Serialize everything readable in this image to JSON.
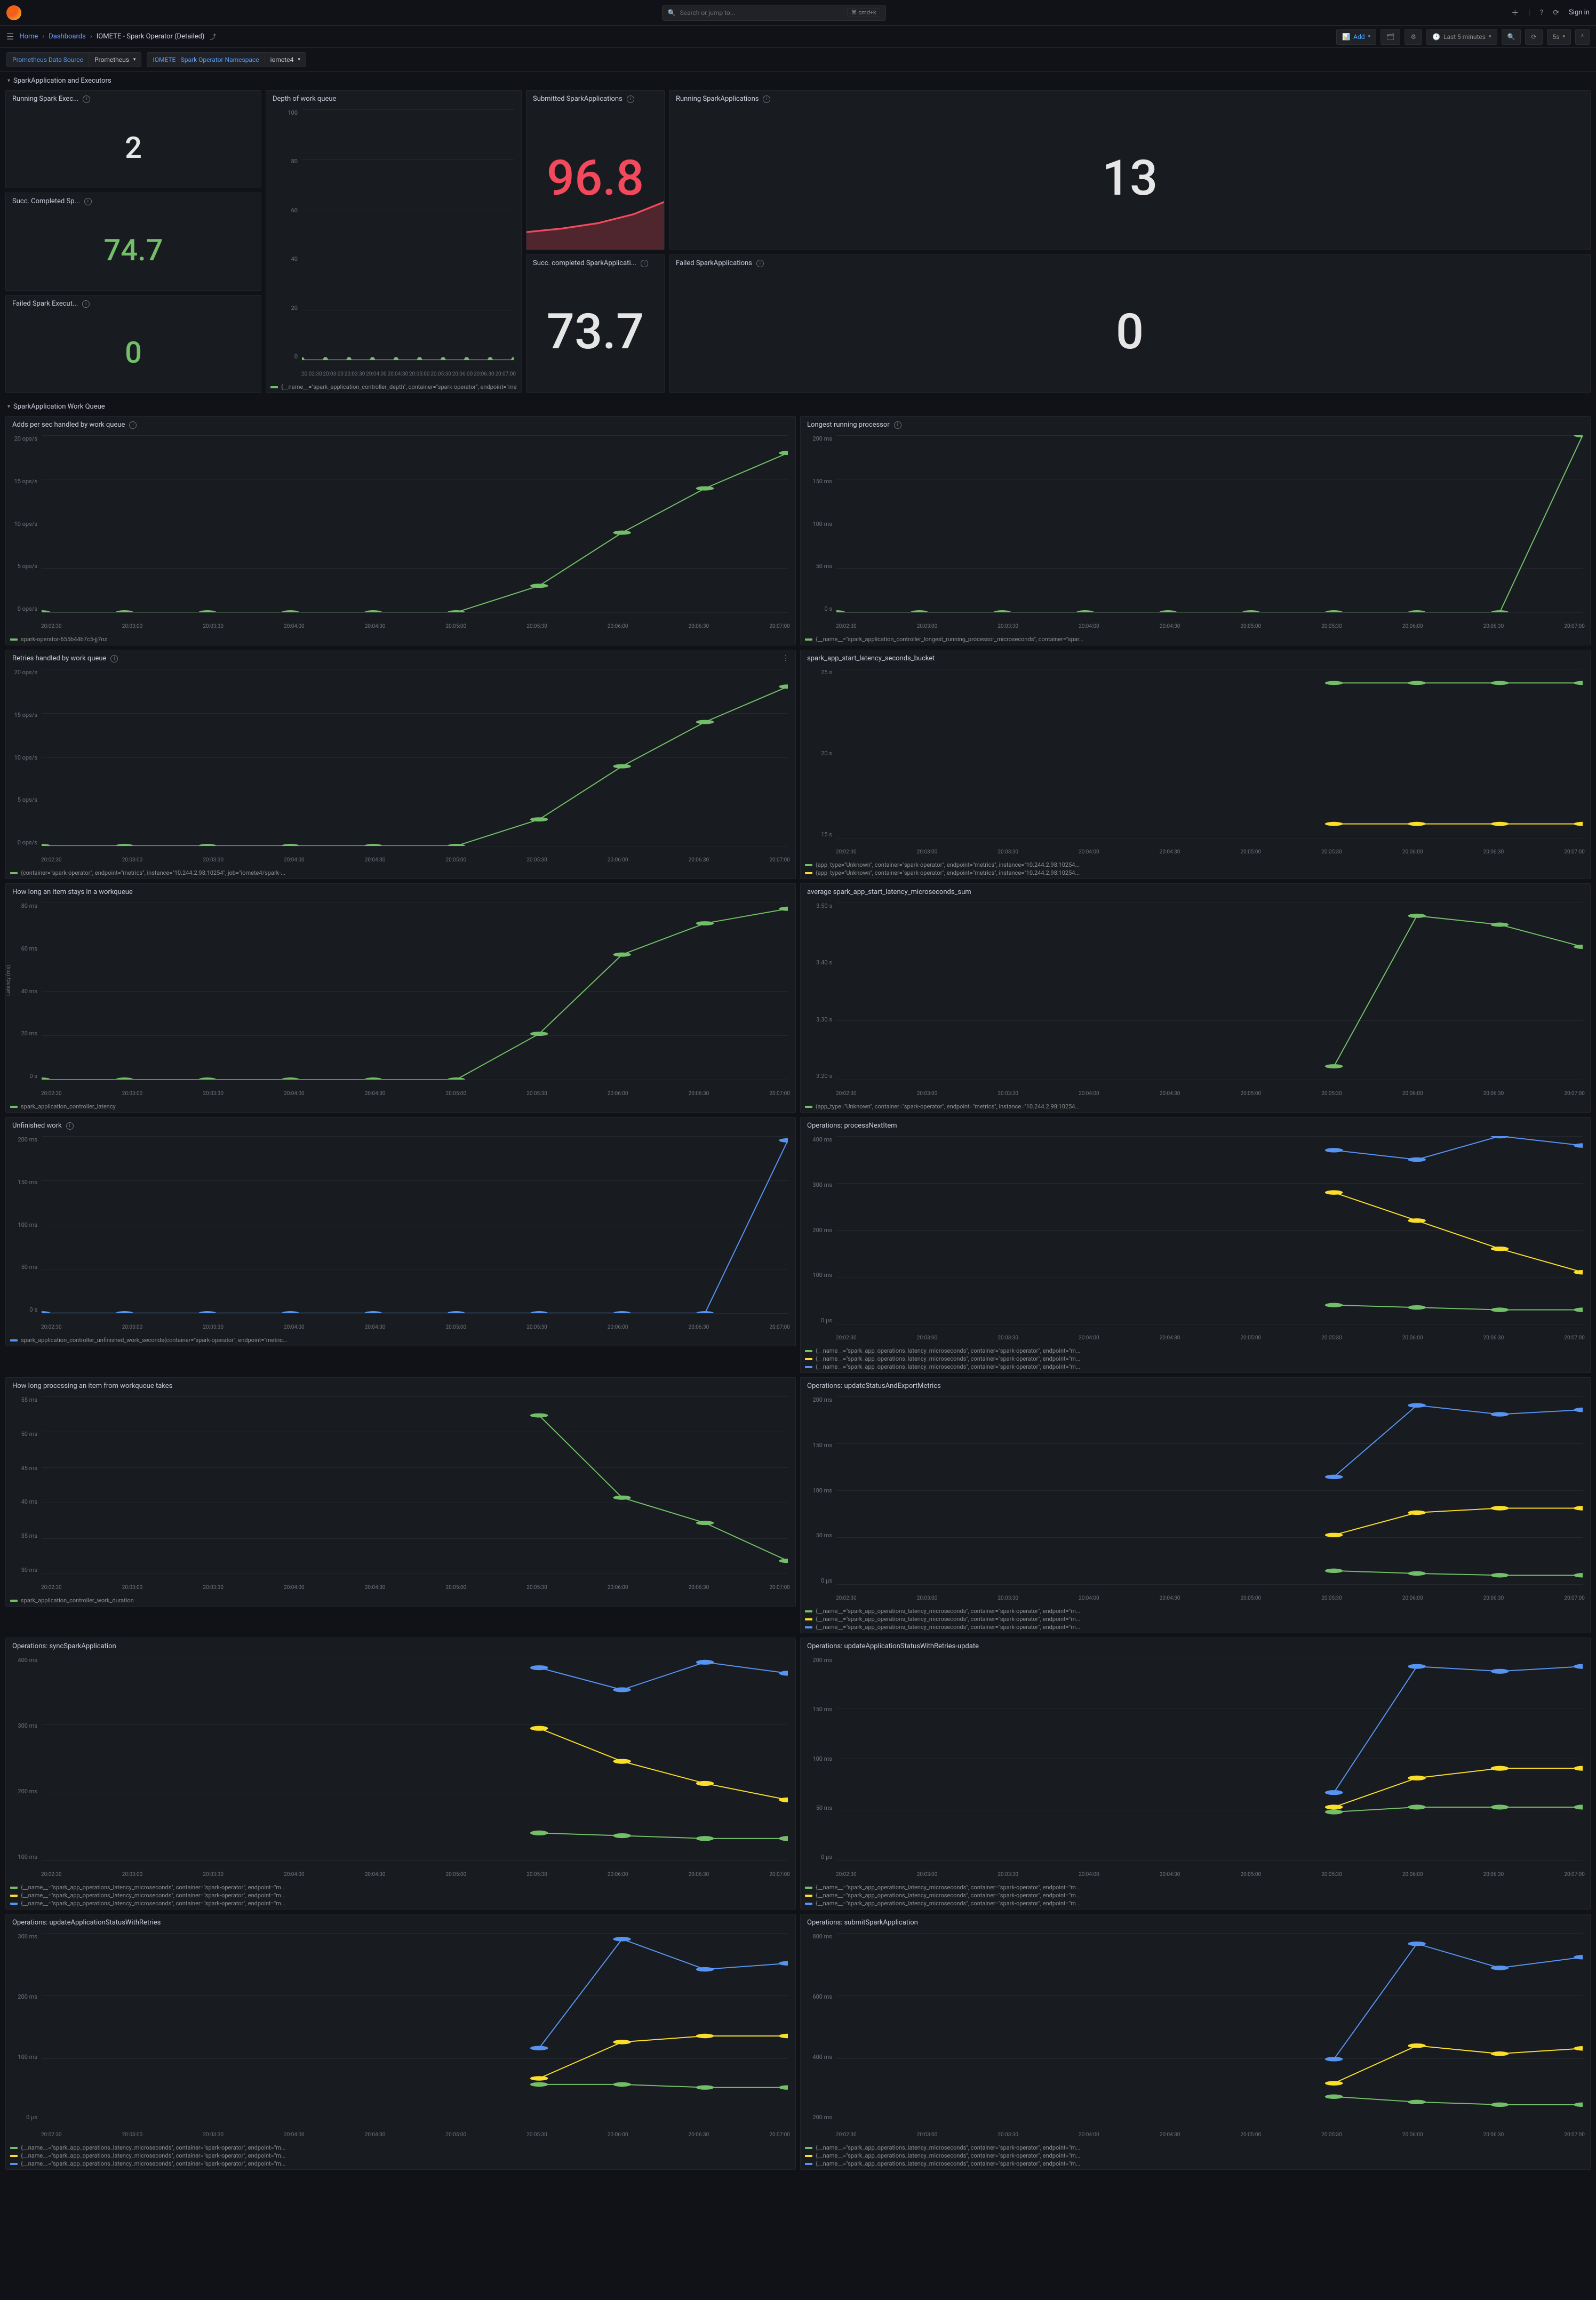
{
  "nav": {
    "search_placeholder": "Search or jump to...",
    "kbd": "⌘ cmd+k",
    "signin": "Sign in"
  },
  "breadcrumbs": {
    "home": "Home",
    "dashboards": "Dashboards",
    "current": "IOMETE - Spark Operator (Detailed)"
  },
  "toolbar": {
    "add": "Add",
    "timerange": "Last 5 minutes",
    "refresh": "5s"
  },
  "vars": {
    "ds_label": "Prometheus Data Source",
    "ds_value": "Prometheus",
    "ns_label": "IOMETE - Spark Operator Namespace",
    "ns_value": "iomete4"
  },
  "sections": {
    "s1": "SparkApplication and Executors",
    "s2": "SparkApplication Work Queue"
  },
  "xticks": [
    "20:02:30",
    "20:03:00",
    "20:03:30",
    "20:04:00",
    "20:04:30",
    "20:05:00",
    "20:05:30",
    "20:06:00",
    "20:06:30",
    "20:07:00"
  ],
  "stats": {
    "submitted": {
      "title": "Submitted SparkApplications",
      "value": "96.8",
      "color": "red",
      "spark": true
    },
    "running": {
      "title": "Running SparkApplications",
      "value": "13",
      "color": "white"
    },
    "succ_pct": {
      "title": "Succ. completed SparkApplicati...",
      "value": "73.7",
      "color": "white"
    },
    "failed": {
      "title": "Failed SparkApplications",
      "value": "0",
      "color": "white"
    },
    "running_exec": {
      "title": "Running Spark Exec...",
      "value": "2",
      "color": "white"
    },
    "succ_sp": {
      "title": "Succ. Completed Sp...",
      "value": "74.7",
      "color": "green"
    },
    "failed_exec": {
      "title": "Failed Spark Execut...",
      "value": "0",
      "color": "green"
    }
  },
  "chart_data": [
    {
      "id": "depth",
      "title": "Depth of work queue",
      "ylim": [
        0,
        100
      ],
      "yticks": [
        "100",
        "80",
        "60",
        "40",
        "20",
        "0"
      ],
      "series": [
        {
          "name": "{__name__=\"spark_application_controller_depth\", container=\"spark-operator\", endpoint=\"metrics\", inst...",
          "color": "#73bf69",
          "values": [
            0,
            0,
            0,
            0,
            0,
            0,
            0,
            0,
            0,
            0
          ]
        }
      ]
    },
    {
      "id": "adds",
      "title": "Adds per sec handled by work queue",
      "ylim": [
        0,
        20
      ],
      "yticks": [
        "20 ops/s",
        "15 ops/s",
        "10 ops/s",
        "5 ops/s",
        "0 ops/s"
      ],
      "series": [
        {
          "name": "spark-operator-655b44b7c5-jj7nz",
          "color": "#73bf69",
          "values": [
            0,
            0,
            0,
            0,
            0,
            0,
            3,
            9,
            14,
            18
          ]
        }
      ]
    },
    {
      "id": "longest",
      "title": "Longest running processor",
      "ylim": [
        0,
        200
      ],
      "yticks": [
        "200 ms",
        "150 ms",
        "100 ms",
        "50 ms",
        "0 s"
      ],
      "series": [
        {
          "name": "{__name__=\"spark_application_controller_longest_running_processor_microseconds\", container=\"spar...",
          "color": "#73bf69",
          "values": [
            0,
            0,
            0,
            0,
            0,
            0,
            0,
            0,
            0,
            200
          ]
        }
      ]
    },
    {
      "id": "retries",
      "title": "Retries handled by work queue",
      "ylim": [
        0,
        20
      ],
      "yticks": [
        "20 ops/s",
        "15 ops/s",
        "10 ops/s",
        "5 ops/s",
        "0 ops/s"
      ],
      "series": [
        {
          "name": "{container=\"spark-operator\", endpoint=\"metrics\", instance=\"10.244.2.98:10254\", job=\"iomete4/spark-...",
          "color": "#73bf69",
          "values": [
            0,
            0,
            0,
            0,
            0,
            0,
            3,
            9,
            14,
            18
          ]
        }
      ]
    },
    {
      "id": "bucket",
      "title": "spark_app_start_latency_seconds_bucket",
      "ylim": [
        15,
        27
      ],
      "yticks": [
        "25 s",
        "20 s",
        "15 s"
      ],
      "series": [
        {
          "name": "{app_type=\"Unknown\", container=\"spark-operator\", endpoint=\"metrics\", instance=\"10.244.2.98:10254...",
          "color": "#73bf69",
          "values": [
            null,
            null,
            null,
            null,
            null,
            null,
            26,
            26,
            26,
            26
          ]
        },
        {
          "name": "{app_type=\"Unknown\", container=\"spark-operator\", endpoint=\"metrics\", instance=\"10.244.2.98:10254...",
          "color": "#fade2a",
          "values": [
            null,
            null,
            null,
            null,
            null,
            null,
            16,
            16,
            16,
            16
          ]
        }
      ]
    },
    {
      "id": "stay",
      "title": "How long an item stays in a workqueue",
      "ylim": [
        0,
        85
      ],
      "yticks": [
        "80 ms",
        "60 ms",
        "40 ms",
        "20 ms",
        "0 s"
      ],
      "ylabel": "Latency (ms)",
      "series": [
        {
          "name": "spark_application_controller_latency",
          "color": "#73bf69",
          "values": [
            0,
            0,
            0,
            0,
            0,
            0,
            22,
            60,
            75,
            82
          ]
        }
      ]
    },
    {
      "id": "avg",
      "title": "average spark_app_start_latency_microseconds_sum",
      "ylim": [
        3.15,
        3.55
      ],
      "yticks": [
        "3.50 s",
        "3.40 s",
        "3.30 s",
        "3.20 s"
      ],
      "series": [
        {
          "name": "{app_type=\"Unknown\", container=\"spark-operator\", endpoint=\"metrics\", instance=\"10.244.2.98:10254...",
          "color": "#73bf69",
          "values": [
            null,
            null,
            null,
            null,
            null,
            null,
            3.18,
            3.52,
            3.5,
            3.45
          ]
        }
      ]
    },
    {
      "id": "unfinished",
      "title": "Unfinished work",
      "ylim": [
        0,
        210
      ],
      "yticks": [
        "200 ms",
        "150 ms",
        "100 ms",
        "50 ms",
        "0 s"
      ],
      "series": [
        {
          "name": "spark_application_controller_unfinished_work_seconds{container=\"spark-operator\", endpoint=\"metric...",
          "color": "#5794f2",
          "values": [
            0,
            0,
            0,
            0,
            0,
            0,
            0,
            0,
            0,
            205
          ]
        }
      ]
    },
    {
      "id": "processNext",
      "title": "Operations: processNextItem",
      "ylim": [
        0,
        400
      ],
      "yticks": [
        "400 ms",
        "300 ms",
        "200 ms",
        "100 ms",
        "0 µs"
      ],
      "series": [
        {
          "name": "{__name__=\"spark_app_operations_latency_microseconds\", container=\"spark-operator\", endpoint=\"m...",
          "color": "#73bf69",
          "values": [
            null,
            null,
            null,
            null,
            null,
            null,
            40,
            35,
            30,
            30
          ]
        },
        {
          "name": "{__name__=\"spark_app_operations_latency_microseconds\", container=\"spark-operator\", endpoint=\"m...",
          "color": "#fade2a",
          "values": [
            null,
            null,
            null,
            null,
            null,
            null,
            280,
            220,
            160,
            110
          ]
        },
        {
          "name": "{__name__=\"spark_app_operations_latency_microseconds\", container=\"spark-operator\", endpoint=\"m...",
          "color": "#5794f2",
          "values": [
            null,
            null,
            null,
            null,
            null,
            null,
            370,
            350,
            400,
            380
          ]
        }
      ]
    },
    {
      "id": "procTakes",
      "title": "How long processing an item from workqueue takes",
      "ylim": [
        28,
        56
      ],
      "yticks": [
        "55 ms",
        "50 ms",
        "45 ms",
        "40 ms",
        "35 ms",
        "30 ms"
      ],
      "series": [
        {
          "name": "spark_application_controller_work_duration",
          "color": "#73bf69",
          "values": [
            null,
            null,
            null,
            null,
            null,
            null,
            53,
            40,
            36,
            30
          ]
        }
      ]
    },
    {
      "id": "updExport",
      "title": "Operations: updateStatusAndExportMetrics",
      "ylim": [
        0,
        210
      ],
      "yticks": [
        "200 ms",
        "150 ms",
        "100 ms",
        "50 ms",
        "0 µs"
      ],
      "series": [
        {
          "name": "{__name__=\"spark_app_operations_latency_microseconds\", container=\"spark-operator\", endpoint=\"m...",
          "color": "#73bf69",
          "values": [
            null,
            null,
            null,
            null,
            null,
            null,
            15,
            12,
            10,
            10
          ]
        },
        {
          "name": "{__name__=\"spark_app_operations_latency_microseconds\", container=\"spark-operator\", endpoint=\"m...",
          "color": "#fade2a",
          "values": [
            null,
            null,
            null,
            null,
            null,
            null,
            55,
            80,
            85,
            85
          ]
        },
        {
          "name": "{__name__=\"spark_app_operations_latency_microseconds\", container=\"spark-operator\", endpoint=\"m...",
          "color": "#5794f2",
          "values": [
            null,
            null,
            null,
            null,
            null,
            null,
            120,
            200,
            190,
            195
          ]
        }
      ]
    },
    {
      "id": "sync",
      "title": "Operations: syncSparkApplication",
      "ylim": [
        50,
        420
      ],
      "yticks": [
        "400 ms",
        "300 ms",
        "200 ms",
        "100 ms"
      ],
      "series": [
        {
          "name": "{__name__=\"spark_app_operations_latency_microseconds\", container=\"spark-operator\", endpoint=\"m...",
          "color": "#73bf69",
          "values": [
            null,
            null,
            null,
            null,
            null,
            null,
            100,
            95,
            90,
            90
          ]
        },
        {
          "name": "{__name__=\"spark_app_operations_latency_microseconds\", container=\"spark-operator\", endpoint=\"m...",
          "color": "#fade2a",
          "values": [
            null,
            null,
            null,
            null,
            null,
            null,
            290,
            230,
            190,
            160
          ]
        },
        {
          "name": "{__name__=\"spark_app_operations_latency_microseconds\", container=\"spark-operator\", endpoint=\"m...",
          "color": "#5794f2",
          "values": [
            null,
            null,
            null,
            null,
            null,
            null,
            400,
            360,
            410,
            390
          ]
        }
      ]
    },
    {
      "id": "updRetriesUpd",
      "title": "Operations: updateApplicationStatusWithRetries-update",
      "ylim": [
        0,
        210
      ],
      "yticks": [
        "200 ms",
        "150 ms",
        "100 ms",
        "50 ms",
        "0 µs"
      ],
      "series": [
        {
          "name": "{__name__=\"spark_app_operations_latency_microseconds\", container=\"spark-operator\", endpoint=\"m...",
          "color": "#73bf69",
          "values": [
            null,
            null,
            null,
            null,
            null,
            null,
            50,
            55,
            55,
            55
          ]
        },
        {
          "name": "{__name__=\"spark_app_operations_latency_microseconds\", container=\"spark-operator\", endpoint=\"m...",
          "color": "#fade2a",
          "values": [
            null,
            null,
            null,
            null,
            null,
            null,
            55,
            85,
            95,
            95
          ]
        },
        {
          "name": "{__name__=\"spark_app_operations_latency_microseconds\", container=\"spark-operator\", endpoint=\"m...",
          "color": "#5794f2",
          "values": [
            null,
            null,
            null,
            null,
            null,
            null,
            70,
            200,
            195,
            200
          ]
        }
      ]
    },
    {
      "id": "updRetries",
      "title": "Operations: updateApplicationStatusWithRetries",
      "ylim": [
        0,
        310
      ],
      "yticks": [
        "300 ms",
        "200 ms",
        "100 ms",
        "0 µs"
      ],
      "series": [
        {
          "name": "{__name__=\"spark_app_operations_latency_microseconds\", container=\"spark-operator\", endpoint=\"m...",
          "color": "#73bf69",
          "values": [
            null,
            null,
            null,
            null,
            null,
            null,
            60,
            60,
            55,
            55
          ]
        },
        {
          "name": "{__name__=\"spark_app_operations_latency_microseconds\", container=\"spark-operator\", endpoint=\"m...",
          "color": "#fade2a",
          "values": [
            null,
            null,
            null,
            null,
            null,
            null,
            70,
            130,
            140,
            140
          ]
        },
        {
          "name": "{__name__=\"spark_app_operations_latency_microseconds\", container=\"spark-operator\", endpoint=\"m...",
          "color": "#5794f2",
          "values": [
            null,
            null,
            null,
            null,
            null,
            null,
            120,
            300,
            250,
            260
          ]
        }
      ]
    },
    {
      "id": "submit",
      "title": "Operations: submitSparkApplication",
      "ylim": [
        150,
        850
      ],
      "yticks": [
        "800 ms",
        "600 ms",
        "400 ms",
        "200 ms"
      ],
      "series": [
        {
          "name": "{__name__=\"spark_app_operations_latency_microseconds\", container=\"spark-operator\", endpoint=\"m...",
          "color": "#73bf69",
          "values": [
            null,
            null,
            null,
            null,
            null,
            null,
            240,
            220,
            210,
            210
          ]
        },
        {
          "name": "{__name__=\"spark_app_operations_latency_microseconds\", container=\"spark-operator\", endpoint=\"m...",
          "color": "#fade2a",
          "values": [
            null,
            null,
            null,
            null,
            null,
            null,
            290,
            430,
            400,
            420
          ]
        },
        {
          "name": "{__name__=\"spark_app_operations_latency_microseconds\", container=\"spark-operator\", endpoint=\"m...",
          "color": "#5794f2",
          "values": [
            null,
            null,
            null,
            null,
            null,
            null,
            380,
            810,
            720,
            760
          ]
        }
      ]
    }
  ]
}
